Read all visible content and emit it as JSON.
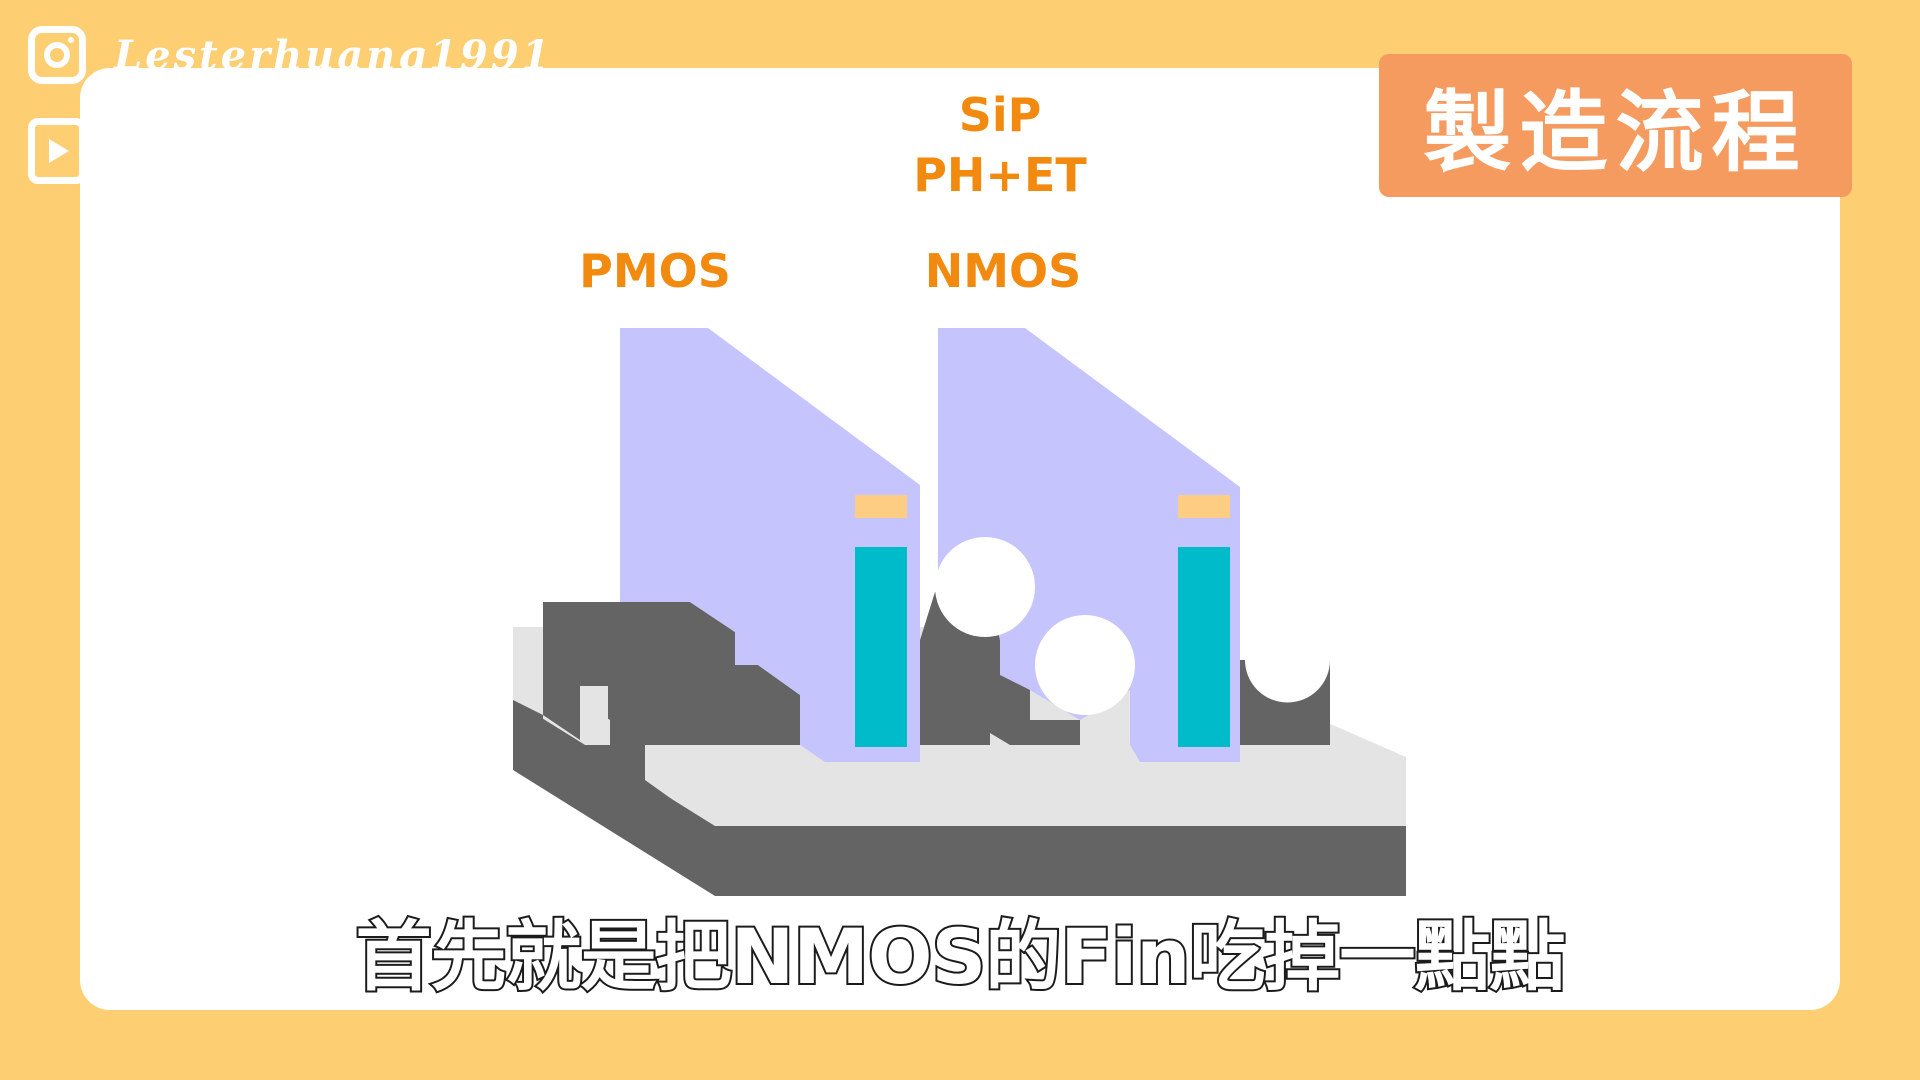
{
  "social": {
    "handle": "Lesterhuang1991",
    "instagram_icon": "instagram-icon",
    "youtube_icon": "youtube-icon"
  },
  "badge": {
    "title": "製造流程"
  },
  "labels": {
    "top_line1": "SiP",
    "top_line2": "PH+ET",
    "pmos": "PMOS",
    "nmos": "NMOS"
  },
  "subtitle": "首先就是把NMOS的Fin吃掉一點點",
  "colors": {
    "background": "#FDCE72",
    "card": "#FFFFFF",
    "badge": "#F59B5F",
    "label": "#F28A10",
    "gate": "#C6C4FC",
    "spacer": "#00BCCB",
    "cap": "#FCCD82",
    "fin_dark": "#646464",
    "substrate_light": "#E4E4E4"
  }
}
